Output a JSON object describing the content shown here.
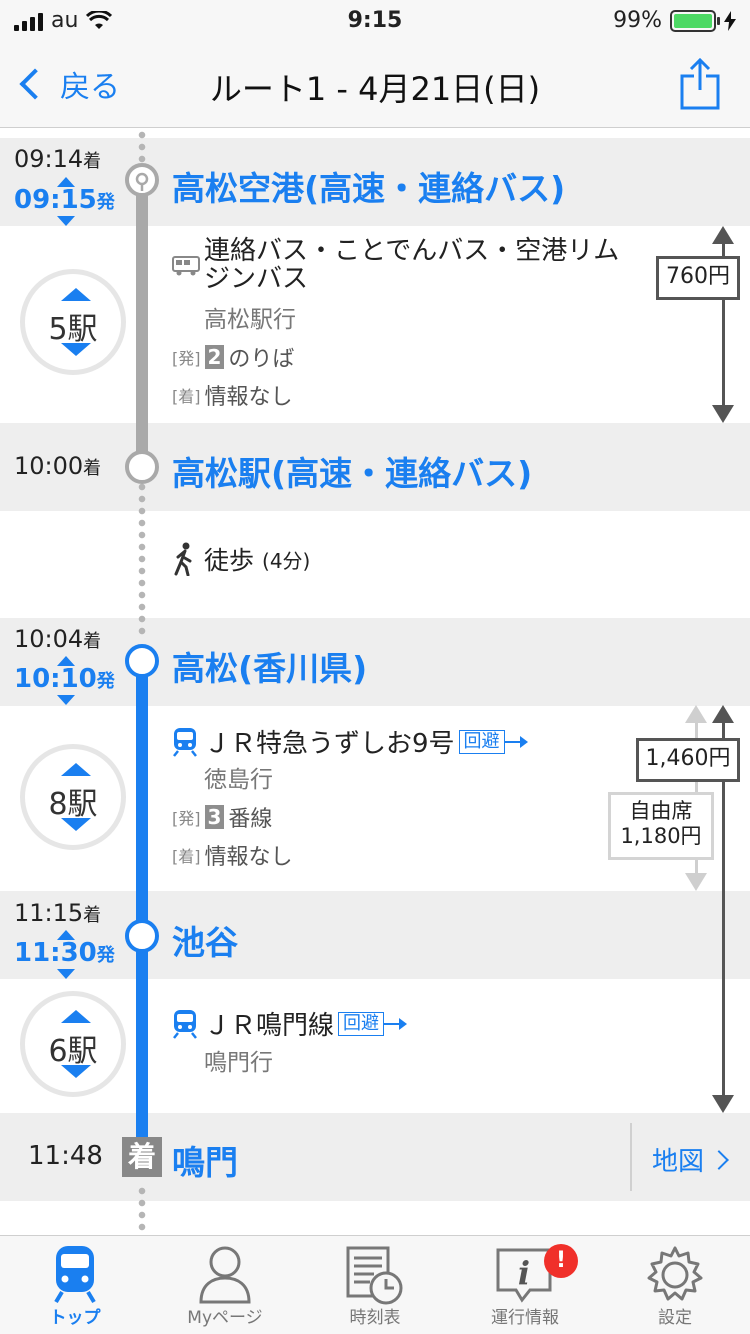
{
  "status_bar": {
    "carrier": "au",
    "time": "9:15",
    "battery": "99%"
  },
  "nav": {
    "back_label": "戻る",
    "title": "ルート1 - 4月21日(日)"
  },
  "colors": {
    "accent": "#1a7ff0",
    "bus_line": "#a9a9a9",
    "rail_line": "#1a7ff0",
    "badge": "#f0302a"
  },
  "segments": {
    "s1": {
      "arrive_time": "09:14",
      "arrive_suffix": "着",
      "depart_time": "09:15",
      "depart_suffix": "発",
      "station": "高松空港(高速・連絡バス)"
    },
    "leg1": {
      "stops": "5駅",
      "service": "連絡バス・ことでんバス・空港リムジンバス",
      "destination": "高松駅行",
      "dep_tag": "[発]",
      "dep_num": "2",
      "dep_text": "のりば",
      "arr_tag": "[着]",
      "arr_text": "情報なし",
      "fare": "760円",
      "icon": "bus-icon"
    },
    "s2": {
      "arrive_time": "10:00",
      "arrive_suffix": "着",
      "station": "高松駅(高速・連絡バス)"
    },
    "walk": {
      "label": "徒歩",
      "duration": "(4分)",
      "icon": "walk-icon"
    },
    "s3": {
      "arrive_time": "10:04",
      "arrive_suffix": "着",
      "depart_time": "10:10",
      "depart_suffix": "発",
      "station": "高松(香川県)"
    },
    "leg2": {
      "stops": "8駅",
      "service": "ＪＲ特急うずしお9号",
      "avoid": "回避",
      "destination": "徳島行",
      "dep_tag": "[発]",
      "dep_num": "3",
      "dep_text": "番線",
      "arr_tag": "[着]",
      "arr_text": "情報なし",
      "fare": "1,460円",
      "fare2_line1": "自由席",
      "fare2_line2": "1,180円",
      "icon": "train-icon"
    },
    "s4": {
      "arrive_time": "11:15",
      "arrive_suffix": "着",
      "depart_time": "11:30",
      "depart_suffix": "発",
      "station": "池谷"
    },
    "leg3": {
      "stops": "6駅",
      "service": "ＪＲ鳴門線",
      "avoid": "回避",
      "destination": "鳴門行",
      "icon": "train-icon"
    },
    "s5": {
      "arrive_time": "11:48",
      "badge": "着",
      "station": "鳴門",
      "map_label": "地図"
    }
  },
  "tabs": [
    {
      "label": "トップ",
      "icon": "train-icon",
      "active": true
    },
    {
      "label": "Myページ",
      "icon": "person-icon"
    },
    {
      "label": "時刻表",
      "icon": "timetable-icon"
    },
    {
      "label": "運行情報",
      "icon": "info-icon",
      "badge": "!"
    },
    {
      "label": "設定",
      "icon": "gear-icon"
    }
  ]
}
